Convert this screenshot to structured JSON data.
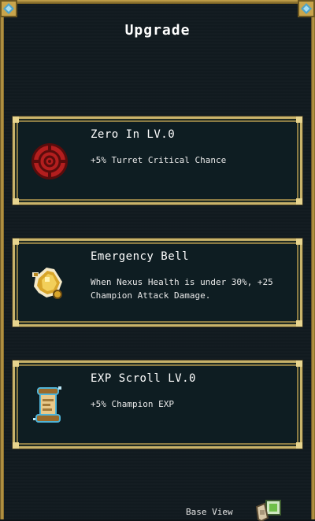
{
  "screen": {
    "title": "Upgrade"
  },
  "upgrades": [
    {
      "name": "Zero In LV.0",
      "description": "+5% Turret Critical Chance",
      "icon": "crosshair-target-icon"
    },
    {
      "name": "Emergency Bell",
      "description": "When Nexus Health is under 30%, +25\nChampion Attack Damage.",
      "icon": "golden-bell-icon"
    },
    {
      "name": "EXP Scroll LV.0",
      "description": "+5% Champion EXP",
      "icon": "scroll-icon"
    }
  ],
  "footer": {
    "base_view_label": "Base View",
    "icon": "base-view-icon"
  },
  "colors": {
    "background": "#111a1f",
    "card_background": "#0e1d22",
    "card_border": "#c9b36a",
    "frame_gold": "#c9a54c",
    "text": "#ffffff"
  }
}
